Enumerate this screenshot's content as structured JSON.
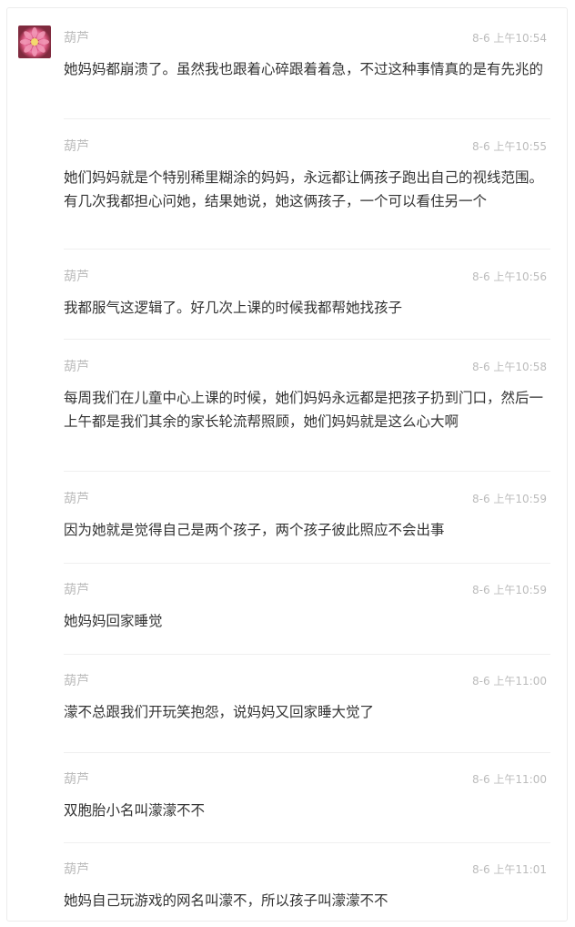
{
  "messages": [
    {
      "name": "葫芦",
      "time": "8-6 上午10:54",
      "text": "她妈妈都崩溃了。虽然我也跟着心碎跟着着急，不过这种事情真的是有先兆的"
    },
    {
      "name": "葫芦",
      "time": "8-6 上午10:55",
      "text": "她们妈妈就是个特别稀里糊涂的妈妈，永远都让俩孩子跑出自己的视线范围。有几次我都担心问她，结果她说，她这俩孩子，一个可以看住另一个"
    },
    {
      "name": "葫芦",
      "time": "8-6 上午10:56",
      "text": "我都服气这逻辑了。好几次上课的时候我都帮她找孩子"
    },
    {
      "name": "葫芦",
      "time": "8-6 上午10:58",
      "text": "每周我们在儿童中心上课的时候，她们妈妈永远都是把孩子扔到门口，然后一上午都是我们其余的家长轮流帮照顾，她们妈妈就是这么心大啊"
    },
    {
      "name": "葫芦",
      "time": "8-6 上午10:59",
      "text": "因为她就是觉得自己是两个孩子，两个孩子彼此照应不会出事"
    },
    {
      "name": "葫芦",
      "time": "8-6 上午10:59",
      "text": "她妈妈回家睡觉"
    },
    {
      "name": "葫芦",
      "time": "8-6 上午11:00",
      "text": "濛不总跟我们开玩笑抱怨，说妈妈又回家睡大觉了"
    },
    {
      "name": "葫芦",
      "time": "8-6 上午11:00",
      "text": "双胞胎小名叫濛濛不不"
    },
    {
      "name": "葫芦",
      "time": "8-6 上午11:01",
      "text": "她妈自己玩游戏的网名叫濛不，所以孩子叫濛濛不不"
    }
  ]
}
